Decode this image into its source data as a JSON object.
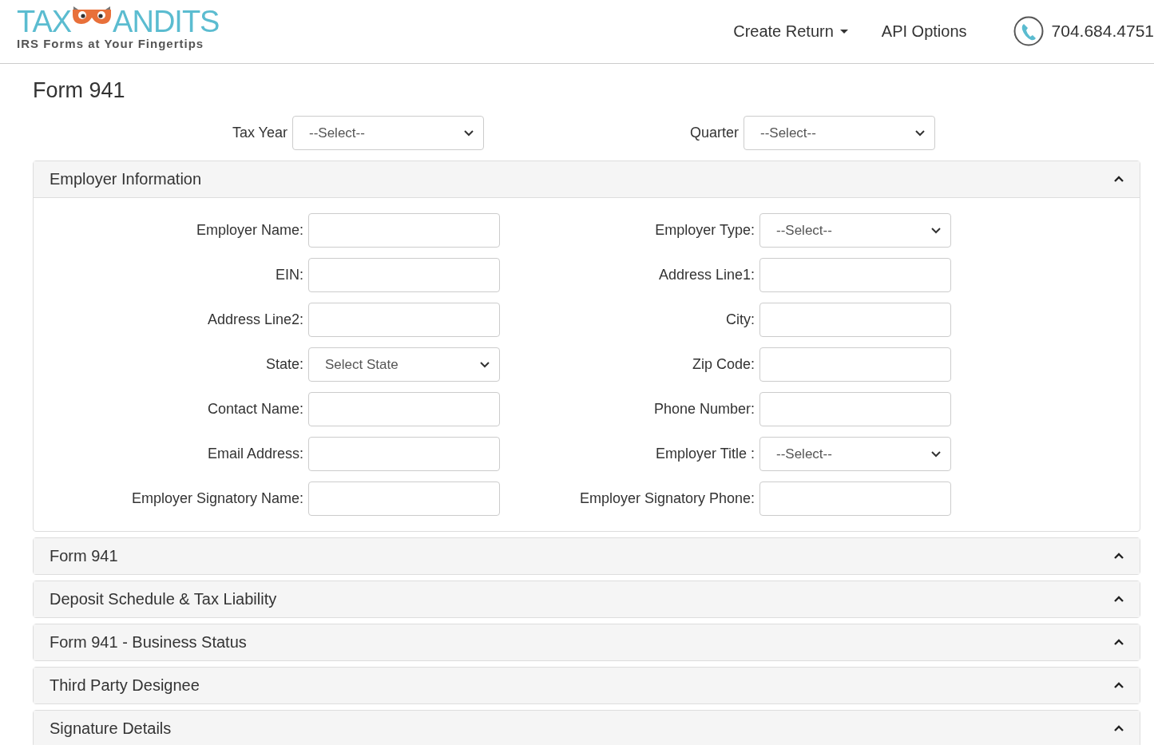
{
  "header": {
    "logo": {
      "left": "TAX",
      "right": "ANDITS",
      "tagline": "IRS Forms at Your Fingertips"
    },
    "nav": [
      {
        "label": "Create Return",
        "dropdown": true
      },
      {
        "label": "API Options",
        "dropdown": false
      }
    ],
    "phone": "704.684.4751"
  },
  "page_title": "Form 941",
  "top_fields": [
    {
      "label": "Tax Year",
      "kind": "select",
      "value": "--Select--"
    },
    {
      "label": "Quarter",
      "kind": "select",
      "value": "--Select--"
    }
  ],
  "panels": [
    {
      "title": "Employer Information",
      "expanded": true,
      "fields": [
        {
          "label": "Employer Name:",
          "kind": "text"
        },
        {
          "label": "Employer Type:",
          "kind": "select",
          "value": "--Select--"
        },
        {
          "label": "EIN:",
          "kind": "text"
        },
        {
          "label": "Address Line1:",
          "kind": "text"
        },
        {
          "label": "Address Line2:",
          "kind": "text"
        },
        {
          "label": "City:",
          "kind": "text"
        },
        {
          "label": "State:",
          "kind": "select",
          "value": "Select State"
        },
        {
          "label": "Zip Code:",
          "kind": "text"
        },
        {
          "label": "Contact Name:",
          "kind": "text"
        },
        {
          "label": "Phone Number:",
          "kind": "text"
        },
        {
          "label": "Email Address:",
          "kind": "text"
        },
        {
          "label": "Employer Title :",
          "kind": "select",
          "value": "--Select--"
        },
        {
          "label": "Employer Signatory Name:",
          "kind": "text"
        },
        {
          "label": "Employer Signatory Phone:",
          "kind": "text"
        }
      ]
    },
    {
      "title": "Form 941",
      "expanded": false
    },
    {
      "title": "Deposit Schedule & Tax Liability",
      "expanded": false
    },
    {
      "title": "Form 941 - Business Status",
      "expanded": false
    },
    {
      "title": "Third Party Designee",
      "expanded": false
    },
    {
      "title": "Signature Details",
      "expanded": false
    }
  ]
}
